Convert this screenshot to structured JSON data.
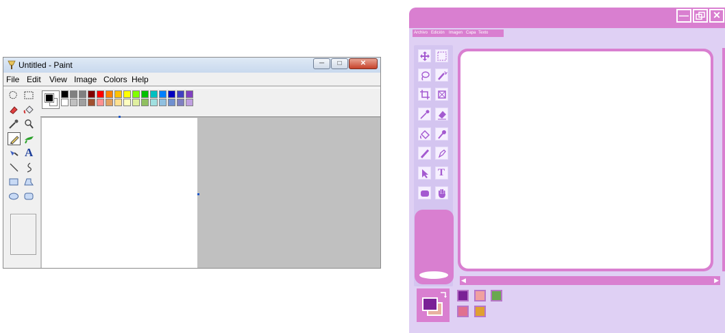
{
  "paint": {
    "title": "Untitled - Paint",
    "window_buttons": [
      "minimize",
      "maximize",
      "close"
    ],
    "menu": [
      "File",
      "Edit",
      "View",
      "Image",
      "Colors",
      "Help"
    ],
    "tools": [
      {
        "name": "free-form-select-icon",
        "selected": false
      },
      {
        "name": "select-icon",
        "selected": false
      },
      {
        "name": "eraser-icon",
        "selected": false
      },
      {
        "name": "fill-bucket-icon",
        "selected": false
      },
      {
        "name": "color-picker-icon",
        "selected": false
      },
      {
        "name": "magnifier-icon",
        "selected": false
      },
      {
        "name": "pencil-icon",
        "selected": true
      },
      {
        "name": "brush-icon",
        "selected": false
      },
      {
        "name": "airbrush-icon",
        "selected": false
      },
      {
        "name": "text-icon",
        "selected": false
      },
      {
        "name": "line-icon",
        "selected": false
      },
      {
        "name": "curve-icon",
        "selected": false
      },
      {
        "name": "rectangle-icon",
        "selected": false
      },
      {
        "name": "polygon-icon",
        "selected": false
      },
      {
        "name": "ellipse-icon",
        "selected": false
      },
      {
        "name": "rounded-rectangle-icon",
        "selected": false
      }
    ],
    "text_tool_glyph": "A",
    "foreground_color": "#000000",
    "background_color": "#ffffff",
    "palette_top": [
      "#000000",
      "#808080",
      "#808080",
      "#800000",
      "#ff0000",
      "#ff8000",
      "#ffc000",
      "#ffff00",
      "#80ff00",
      "#00c000",
      "#00c0c0",
      "#0080ff",
      "#0000c0",
      "#4040c0",
      "#8040c0"
    ],
    "palette_bottom": [
      "#ffffff",
      "#c0c0c0",
      "#a0a0a0",
      "#a05030",
      "#ff9090",
      "#e0a060",
      "#ffe090",
      "#ffffc0",
      "#e0f0a0",
      "#90c060",
      "#a0e0e0",
      "#90c0e0",
      "#7090d0",
      "#8080c0",
      "#c0a0e0"
    ],
    "workspace_color": "#c0c0c0"
  },
  "pink": {
    "window_buttons": [
      "minimize",
      "restore",
      "close"
    ],
    "menu": [
      "Archivo",
      "Edición",
      "Imagen",
      "Capa",
      "Texto"
    ],
    "tools": [
      "move-icon",
      "marquee-select-icon",
      "lasso-icon",
      "magic-wand-icon",
      "crop-icon",
      "resize-icon",
      "color-picker-icon",
      "eraser-icon",
      "fill-bucket-icon",
      "brush-icon",
      "pencil-icon",
      "pen-icon",
      "pointer-icon",
      "text-icon",
      "shape-icon",
      "hand-icon"
    ],
    "text_tool_glyph": "T",
    "primary_color": "#7a2196",
    "secondary_color": "#e8b1a0",
    "swatches": [
      "#7a2196",
      "#f0a0a0",
      "#6aa84f",
      "#e07090",
      "#e0a030"
    ],
    "accent": "#d97fd0",
    "panel": "#dfd0f4"
  }
}
